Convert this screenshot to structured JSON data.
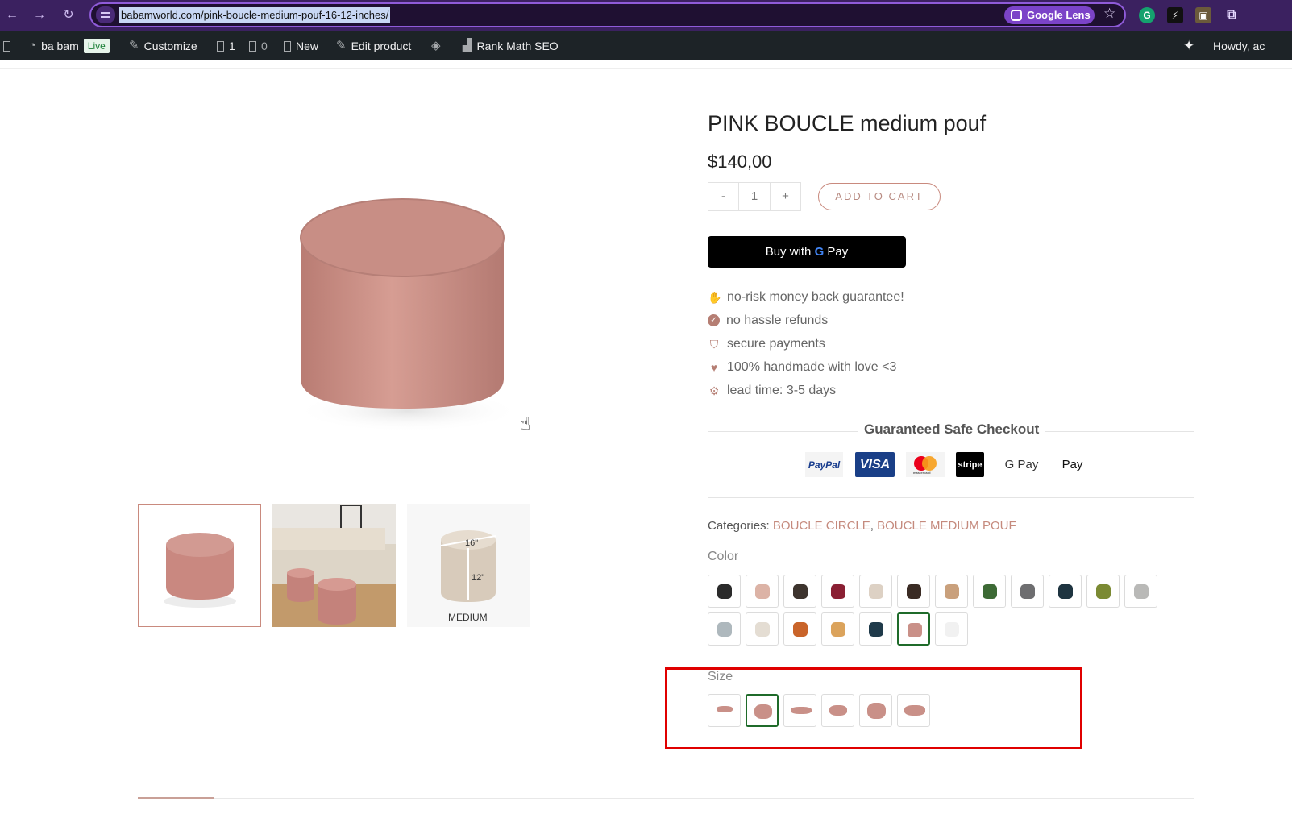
{
  "browser": {
    "url": "babamworld.com/pink-boucle-medium-pouf-16-12-inches/",
    "lens_label": "Google Lens",
    "icons": [
      "back-icon",
      "forward-icon",
      "reload-icon",
      "site-info-icon",
      "google-lens-icon",
      "bookmark-star-icon",
      "grammarly-icon",
      "extension-bolt-icon",
      "extension-id-icon",
      "extensions-puzzle-icon"
    ]
  },
  "adminbar": {
    "site_name": "ba bam",
    "live_badge": "Live",
    "customize": "Customize",
    "comments_count": "1",
    "updates_count": "0",
    "new": "New",
    "edit_product": "Edit product",
    "rank_math": "Rank Math SEO",
    "howdy": "Howdy, ac"
  },
  "product": {
    "title": "PINK BOUCLE medium pouf",
    "price": "$140,00",
    "qty_minus": "-",
    "qty_value": "1",
    "qty_plus": "+",
    "add_to_cart": "ADD TO CART",
    "gpay_prefix": "Buy with",
    "gpay_g": "G",
    "gpay_suffix": "Pay",
    "thumb_dims": {
      "top": "16\"",
      "side": "12\"",
      "caption": "MEDIUM"
    }
  },
  "features": [
    {
      "icon": "hand-money-icon",
      "text": "no-risk money back guarantee!"
    },
    {
      "icon": "check-circle-icon",
      "text": "no hassle refunds"
    },
    {
      "icon": "shield-icon",
      "text": "secure payments"
    },
    {
      "icon": "heart-icon",
      "text": "100% handmade with love <3"
    },
    {
      "icon": "gear-icon",
      "text": "lead time: 3-5 days"
    }
  ],
  "checkout": {
    "title": "Guaranteed Safe Checkout",
    "methods": [
      "PayPal",
      "VISA",
      "mastercard",
      "stripe",
      "G Pay",
      " Pay"
    ]
  },
  "categories": {
    "label": "Categories:",
    "items": [
      "BOUCLE CIRCLE",
      "BOUCLE MEDIUM POUF"
    ],
    "sep": ", "
  },
  "color": {
    "label": "Color",
    "swatches": [
      "#2b2b2b",
      "#dcb3a6",
      "#3d342e",
      "#8a1f33",
      "#ddd1c4",
      "#3a2b24",
      "#c9a07c",
      "#3d6a35",
      "#6e6e70",
      "#1e3440",
      "#7b8a33",
      "#b9b9b7",
      "#aeb8bd",
      "#e4ddd3",
      "#c9642a",
      "#dba35c",
      "#1f3a4a",
      "#c99088",
      "#f1f1f1"
    ],
    "selected_index": 17
  },
  "size": {
    "label": "Size",
    "selected_index": 1
  }
}
